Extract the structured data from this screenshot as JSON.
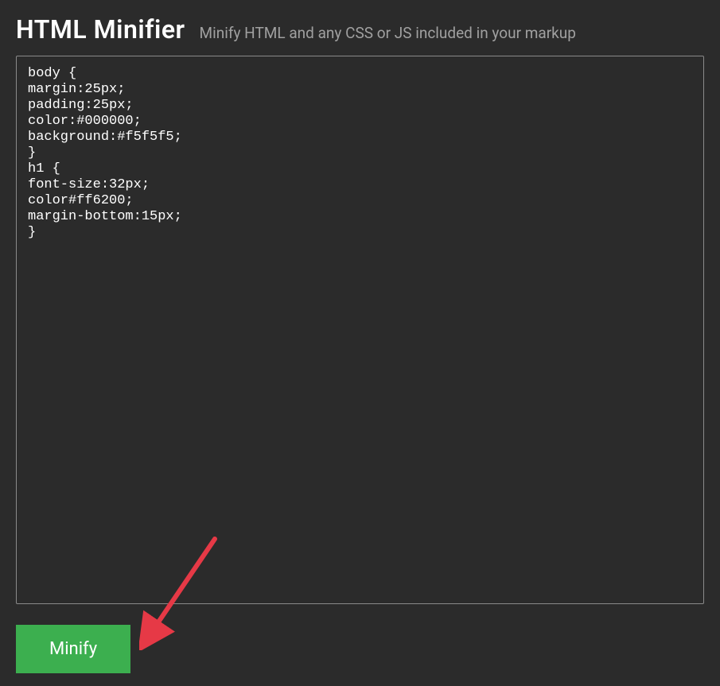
{
  "header": {
    "title": "HTML Minifier",
    "subtitle": "Minify HTML and any CSS or JS included in your markup"
  },
  "editor": {
    "content": "body {\nmargin:25px;\npadding:25px;\ncolor:#000000;\nbackground:#f5f5f5;\n}\nh1 {\nfont-size:32px;\ncolor#ff6200;\nmargin-bottom:15px;\n}"
  },
  "actions": {
    "minify_label": "Minify"
  },
  "annotation": {
    "arrow_color": "#e63946"
  }
}
